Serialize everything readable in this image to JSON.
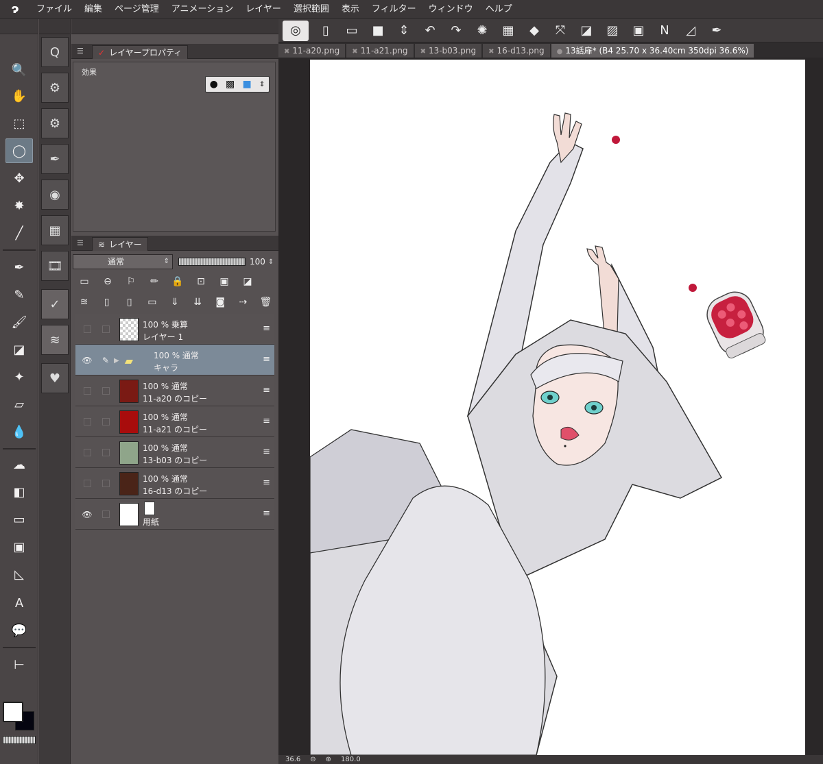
{
  "menubar": {
    "items": [
      "ファイル",
      "編集",
      "ページ管理",
      "アニメーション",
      "レイヤー",
      "選択範囲",
      "表示",
      "フィルター",
      "ウィンドウ",
      "ヘルプ"
    ]
  },
  "toolbar": {
    "icons": [
      "logo-icon",
      "new-icon",
      "open-icon",
      "save-icon",
      "swap-icon",
      "undo-icon",
      "redo-icon",
      "settings-icon",
      "transform-icon",
      "clear-icon",
      "fit-icon",
      "ruler-icon",
      "shade-icon",
      "select-icon",
      "stroke-icon",
      "curve-icon",
      "pen-icon"
    ]
  },
  "tabs": [
    {
      "label": "11-a20.png",
      "active": false
    },
    {
      "label": "11-a21.png",
      "active": false
    },
    {
      "label": "13-b03.png",
      "active": false
    },
    {
      "label": "16-d13.png",
      "active": false
    },
    {
      "label": "13話扉* (B4 25.70 x 36.40cm 350dpi 36.6%)",
      "active": true
    }
  ],
  "layer_property": {
    "title": "レイヤープロパティ",
    "effects_label": "効果"
  },
  "layer_panel": {
    "title": "レイヤー",
    "blend_mode": "通常",
    "opacity": "100"
  },
  "layers": [
    {
      "line1": "100 % 乗算",
      "line2": "レイヤー 1",
      "visible": false,
      "selected": false,
      "thumb": "checker"
    },
    {
      "line1": "100 % 通常",
      "line2": "キャラ",
      "visible": true,
      "selected": true,
      "thumb": "folder"
    },
    {
      "line1": "100 % 通常",
      "line2": "11-a20 のコピー",
      "visible": false,
      "selected": false,
      "thumb": "#7a1a14"
    },
    {
      "line1": "100 % 通常",
      "line2": "11-a21 のコピー",
      "visible": false,
      "selected": false,
      "thumb": "#a80c0c"
    },
    {
      "line1": "100 % 通常",
      "line2": "13-b03 のコピー",
      "visible": false,
      "selected": false,
      "thumb": "#8fa58a"
    },
    {
      "line1": "100 % 通常",
      "line2": "16-d13 のコピー",
      "visible": false,
      "selected": false,
      "thumb": "#4a2418"
    },
    {
      "line1": "",
      "line2": "用紙",
      "visible": true,
      "selected": false,
      "thumb": "white"
    }
  ],
  "status": {
    "zoom": "36.6",
    "rotation": "180.0"
  },
  "colors": {
    "accent": "#7c8a98",
    "canvas": "#ffffff",
    "panel": "#565152"
  }
}
